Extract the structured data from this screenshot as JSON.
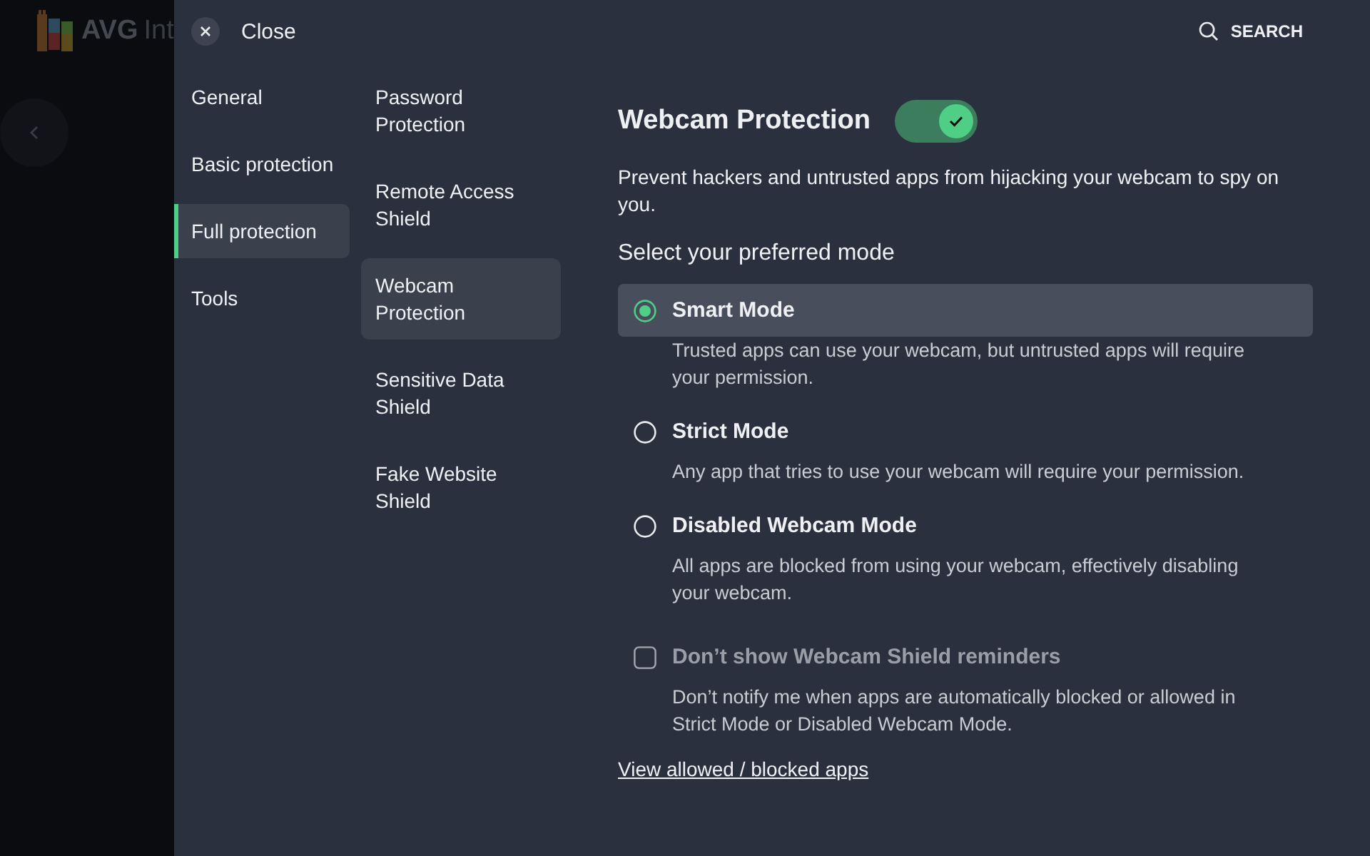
{
  "background_app": {
    "logo_text": "AVG",
    "title_fragment": "Int"
  },
  "header": {
    "close_label": "Close",
    "search_label": "SEARCH"
  },
  "categories": [
    {
      "label": "General",
      "selected": false
    },
    {
      "label": "Basic protection",
      "selected": false
    },
    {
      "label": "Full protection",
      "selected": true
    },
    {
      "label": "Tools",
      "selected": false
    }
  ],
  "features": [
    {
      "label": "Password Protection",
      "selected": false
    },
    {
      "label": "Remote Access Shield",
      "selected": false
    },
    {
      "label": "Webcam Protection",
      "selected": true
    },
    {
      "label": "Sensitive Data Shield",
      "selected": false
    },
    {
      "label": "Fake Website Shield",
      "selected": false
    }
  ],
  "content": {
    "title": "Webcam Protection",
    "enabled": true,
    "description": "Prevent hackers and untrusted apps from hijacking your webcam to spy on you.",
    "mode_prompt": "Select your preferred mode",
    "modes": [
      {
        "label": "Smart Mode",
        "description": "Trusted apps can use your webcam, but untrusted apps will require your permission.",
        "selected": true
      },
      {
        "label": "Strict Mode",
        "description": "Any app that tries to use your webcam will require your permission.",
        "selected": false
      },
      {
        "label": "Disabled Webcam Mode",
        "description": "All apps are blocked from using your webcam, effectively disabling your webcam.",
        "selected": false
      }
    ],
    "reminders": {
      "label": "Don’t show Webcam Shield reminders",
      "checked": false,
      "disabled": true,
      "description": "Don’t notify me when apps are automatically blocked or allowed in Strict Mode or Disabled Webcam Mode."
    },
    "link": "View allowed / blocked apps"
  }
}
